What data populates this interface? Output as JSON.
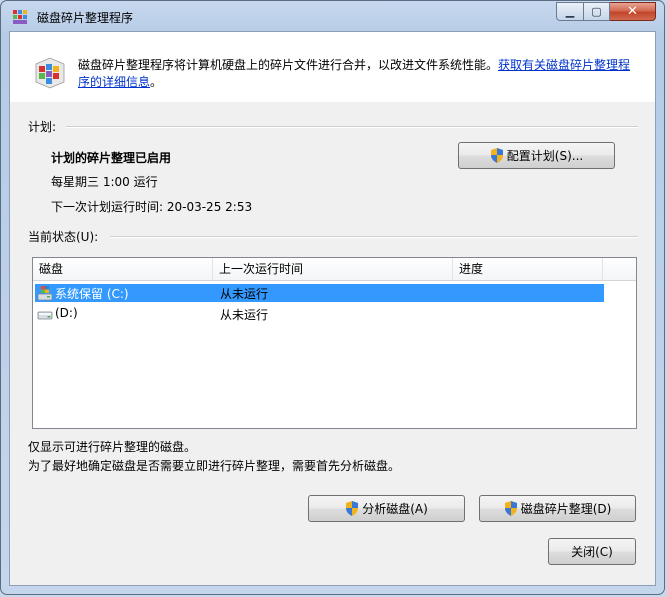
{
  "window": {
    "title": "磁盘碎片整理程序",
    "min_glyph": "▁",
    "max_glyph": "▢",
    "close_glyph": "✕"
  },
  "header": {
    "description": "磁盘碎片整理程序将计算机硬盘上的碎片文件进行合并，以改进文件系统性能。",
    "link": "获取有关磁盘碎片整理程序的详细信息",
    "link_suffix": "。"
  },
  "schedule": {
    "section_label": "计划:",
    "status": "计划的碎片整理已启用",
    "frequency": "每星期三  1:00 运行",
    "next_run": "下一次计划运行时间: 20-03-25 2:53",
    "configure_button": "配置计划(S)..."
  },
  "current_status": {
    "section_label": "当前状态(U):",
    "columns": [
      "磁盘",
      "上一次运行时间",
      "进度"
    ],
    "disks": [
      {
        "name": "系统保留 (C:)",
        "last_run": "从未运行",
        "progress": "",
        "selected": true,
        "icon": "system-drive-icon"
      },
      {
        "name": "(D:)",
        "last_run": "从未运行",
        "progress": "",
        "selected": false,
        "icon": "hard-drive-icon"
      }
    ]
  },
  "notes": {
    "line1": "仅显示可进行碎片整理的磁盘。",
    "line2": "为了最好地确定磁盘是否需要立即进行碎片整理，需要首先分析磁盘。"
  },
  "actions": {
    "analyze_button": "分析磁盘(A)",
    "defrag_button": "磁盘碎片整理(D)",
    "close_button": "关闭(C)"
  },
  "colors": {
    "selection": "#3399ff",
    "link": "#0033cc"
  }
}
